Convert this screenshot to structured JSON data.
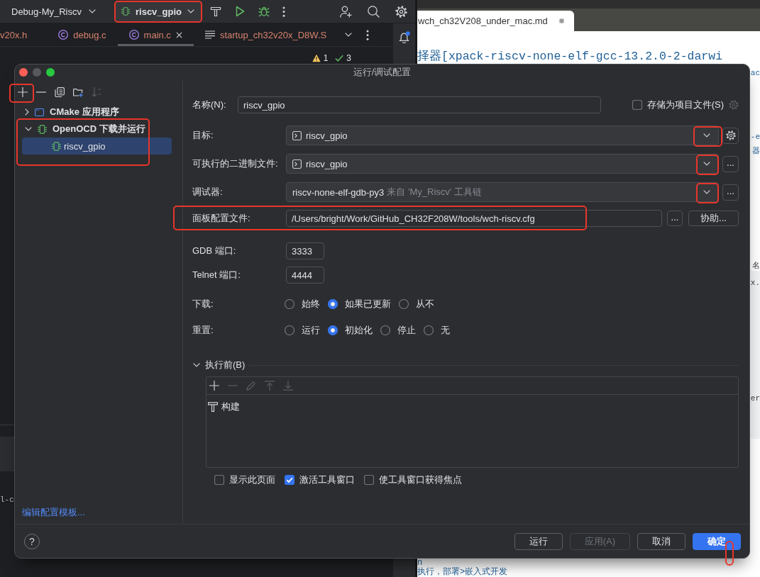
{
  "ide": {
    "project": "Debug-My_Riscv",
    "run_config": {
      "label": "riscv_gpio",
      "highlighted": true
    },
    "editor_tabs": [
      {
        "label": "v20x.h",
        "kind": "header",
        "selected": false
      },
      {
        "label": "debug.c",
        "kind": "c_source",
        "selected": false
      },
      {
        "label": "main.c",
        "kind": "c_source",
        "selected": true
      },
      {
        "label": "startup_ch32v20x_D8W.S",
        "kind": "assembly",
        "selected": false
      }
    ],
    "inspections": {
      "warnings": "1",
      "passed": "3"
    },
    "notifications": {
      "unread": true
    },
    "terminal_fragment": "l-c"
  },
  "browser": {
    "tab": {
      "label": "wch_ch32V208_under_mac.md",
      "modified": true
    },
    "document": [
      {
        "kind": "paragraph",
        "lines": [
          {
            "text": "择器[xpack-riscv-none-elf-gcc-13.2.0-2-darwi",
            "start_hidden": false,
            "link": true
          },
          {
            "text": "ac",
            "start_hidden": true,
            "link": true
          }
        ]
      },
      {
        "kind": "paragraph",
        "lines": [
          {
            "text": "-e",
            "start_hidden": true,
            "link": true
          },
          {
            "text": "器",
            "start_hidden": true,
            "link": true
          }
        ]
      },
      {
        "kind": "paragraph",
        "lines": [
          {
            "text": "名",
            "start_hidden": true,
            "link": false
          }
        ]
      },
      {
        "kind": "code",
        "lines": [
          {
            "text": "x.",
            "start_hidden": true,
            "link": false
          },
          {
            "text": "er",
            "start_hidden": true,
            "link": false
          }
        ]
      },
      {
        "kind": "paragraph",
        "lines": [
          {
            "text": "n",
            "start_hidden": false,
            "link": true
          },
          {
            "text": "执行，部署>嵌入式开发",
            "start_hidden": false,
            "link": true
          }
        ]
      }
    ]
  },
  "dialog": {
    "title": "运行/调试配置",
    "toolbar": [
      {
        "kind": "add",
        "disabled": false,
        "highlighted": true
      },
      {
        "kind": "remove",
        "disabled": false,
        "highlighted": false
      },
      {
        "kind": "copy",
        "disabled": false,
        "highlighted": false
      },
      {
        "kind": "new_folder",
        "disabled": false,
        "highlighted": false
      },
      {
        "kind": "sort",
        "disabled": true,
        "highlighted": false
      }
    ],
    "tree": [
      {
        "label": "CMake 应用程序",
        "kind": "cmake",
        "expanded": false,
        "selected": false,
        "highlighted": false
      },
      {
        "label": "OpenOCD 下载并运行",
        "kind": "openocd",
        "expanded": true,
        "selected": false,
        "highlighted": true,
        "children": [
          {
            "label": "riscv_gpio",
            "kind": "openocd",
            "selected": true
          }
        ]
      }
    ],
    "templates_link": "编辑配置模板...",
    "form": {
      "name": {
        "label": "名称(N):",
        "value": "riscv_gpio"
      },
      "store_as_project_file": {
        "label": "存储为项目文件(S)",
        "checked": false
      },
      "target": {
        "label": "目标:",
        "value": "riscv_gpio",
        "highlighted": true
      },
      "executable": {
        "label": "可执行的二进制文件:",
        "value": "riscv_gpio",
        "browse": "...",
        "highlighted": true
      },
      "debugger": {
        "label": "调试器:",
        "value": "riscv-none-elf-gdb-py3",
        "hint": "来自 'My_Riscv' 工具链",
        "browse": "...",
        "highlighted": true
      },
      "board_config": {
        "label": "面板配置文件:",
        "value": "/Users/bright/Work/GitHub_CH32F208W/tools/wch-riscv.cfg",
        "browse": "...",
        "assist": "协助...",
        "highlighted": true
      },
      "gdb_port": {
        "label": "GDB 端口:",
        "value": "3333"
      },
      "telnet_port": {
        "label": "Telnet 端口:",
        "value": "4444"
      },
      "download": {
        "label": "下载:",
        "options": [
          {
            "label": "始终",
            "selected": false
          },
          {
            "label": "如果已更新",
            "selected": true
          },
          {
            "label": "从不",
            "selected": false
          }
        ]
      },
      "reset": {
        "label": "重置:",
        "options": [
          {
            "label": "运行",
            "selected": false
          },
          {
            "label": "初始化",
            "selected": true
          },
          {
            "label": "停止",
            "selected": false
          },
          {
            "label": "无",
            "selected": false
          }
        ]
      },
      "before_launch": {
        "title": "执行前(B)",
        "expanded": true,
        "toolbar": [
          {
            "kind": "add",
            "disabled": false
          },
          {
            "kind": "remove",
            "disabled": true
          },
          {
            "kind": "edit",
            "disabled": true
          },
          {
            "kind": "move_up",
            "disabled": true
          },
          {
            "kind": "move_down",
            "disabled": true
          }
        ],
        "tasks": [
          {
            "label": "构建"
          }
        ]
      },
      "options": [
        {
          "label": "显示此页面",
          "checked": false
        },
        {
          "label": "激活工具窗口",
          "checked": true
        },
        {
          "label": "使工具窗口获得焦点",
          "checked": false
        }
      ]
    },
    "help": "?",
    "buttons": [
      {
        "label": "运行",
        "primary": false,
        "disabled": false,
        "highlighted": false
      },
      {
        "label": "应用(A)",
        "primary": false,
        "disabled": true,
        "highlighted": false
      },
      {
        "label": "取消",
        "primary": false,
        "disabled": false,
        "highlighted": false
      },
      {
        "label": "确定",
        "primary": true,
        "disabled": false,
        "highlighted": true
      }
    ]
  }
}
